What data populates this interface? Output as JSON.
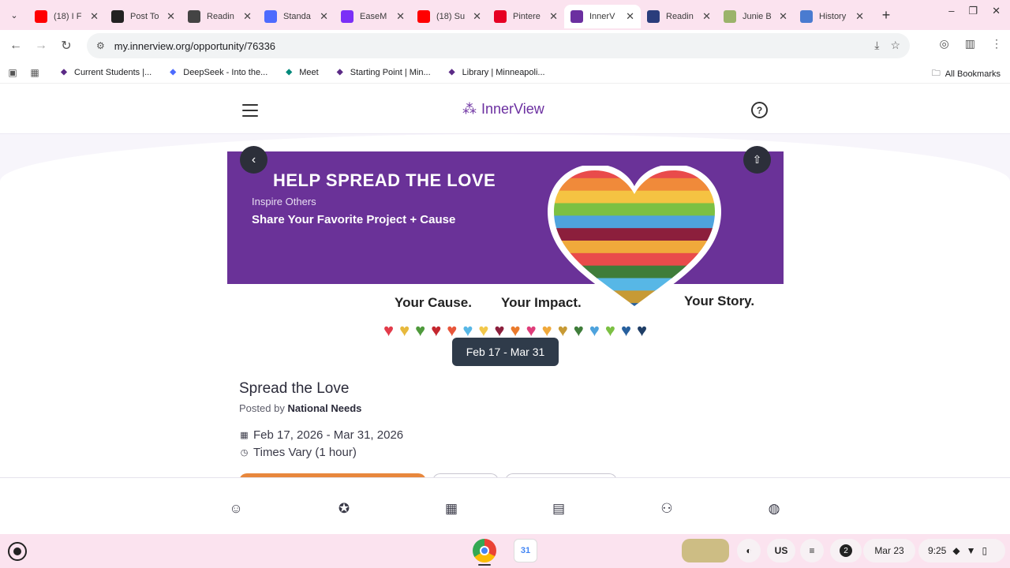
{
  "browser": {
    "tabs": [
      {
        "title": "(18) I F",
        "favicon": "youtube-icon",
        "color": "#ff0000",
        "active": false
      },
      {
        "title": "Post To",
        "favicon": "threads-icon",
        "color": "#222222",
        "active": false
      },
      {
        "title": "Readin",
        "favicon": "openai-icon",
        "color": "#444444",
        "active": false
      },
      {
        "title": "Standa",
        "favicon": "deepseek-icon",
        "color": "#4d6bfe",
        "active": false
      },
      {
        "title": "EaseM",
        "favicon": "easemate-icon",
        "color": "#7b2ff7",
        "active": false
      },
      {
        "title": "(18) Su",
        "favicon": "youtube-icon",
        "color": "#ff0000",
        "active": false
      },
      {
        "title": "Pintere",
        "favicon": "pinterest-icon",
        "color": "#e60023",
        "active": false
      },
      {
        "title": "InnerV",
        "favicon": "innerview-icon",
        "color": "#6b2fa0",
        "active": true
      },
      {
        "title": "Readin",
        "favicon": "bookmark-app-icon",
        "color": "#2a3d7c",
        "active": false
      },
      {
        "title": "Junie B",
        "favicon": "image-icon",
        "color": "#9bb36a",
        "active": false
      },
      {
        "title": "History",
        "favicon": "history-icon",
        "color": "#4a7bd0",
        "active": false
      }
    ],
    "url": "my.innerview.org/opportunity/76336",
    "bookmarks": [
      {
        "label": "Current Students |...",
        "icon": "m-icon",
        "color": "#5b2a86"
      },
      {
        "label": "DeepSeek - Into the...",
        "icon": "deepseek-icon",
        "color": "#4d6bfe"
      },
      {
        "label": "Meet",
        "icon": "meet-icon",
        "color": "#00897b"
      },
      {
        "label": "Starting Point | Min...",
        "icon": "m-icon",
        "color": "#5b2a86"
      },
      {
        "label": "Library | Minneapoli...",
        "icon": "m-icon",
        "color": "#5b2a86"
      }
    ],
    "all_bookmarks_label": "All Bookmarks"
  },
  "app": {
    "brand": "InnerView",
    "banner": {
      "headline": "HELP SPREAD THE LOVE",
      "subline": "Inspire Others",
      "subline2": "Share Your Favorite Project + Cause",
      "tag1": "Your Cause.",
      "tag2": "Your Impact.",
      "tag3": "Your Story.",
      "heart_colors": [
        "#e23b4a",
        "#e7b93d",
        "#4f9a3c",
        "#c4262e",
        "#e8563b",
        "#57b7e6",
        "#f2c84b",
        "#8c1f3c",
        "#ea7a2c",
        "#df3d7a",
        "#f0a93b",
        "#c79a35",
        "#3f7d3a",
        "#4ea3dd",
        "#7cc043",
        "#27609e",
        "#1f3e66"
      ],
      "stripe_colors": [
        "#e94b4b",
        "#f08a3a",
        "#f5c342",
        "#7cc043",
        "#4ea3dd",
        "#8c1f3c",
        "#f0a93b",
        "#e94b4b",
        "#3f7d3a",
        "#57b7e6",
        "#c79a35",
        "#27609e"
      ]
    },
    "date_pill": "Feb 17 - Mar 31",
    "title": "Spread the Love",
    "posted_by_label": "Posted by",
    "posted_by_org": "National Needs",
    "date_range": "Feb 17, 2026 - Mar 31, 2026",
    "times": "Times Vary (1 hour)"
  },
  "shelf": {
    "keyboard": "US",
    "notifications": "2",
    "date": "Mar 23",
    "time": "9:25"
  }
}
